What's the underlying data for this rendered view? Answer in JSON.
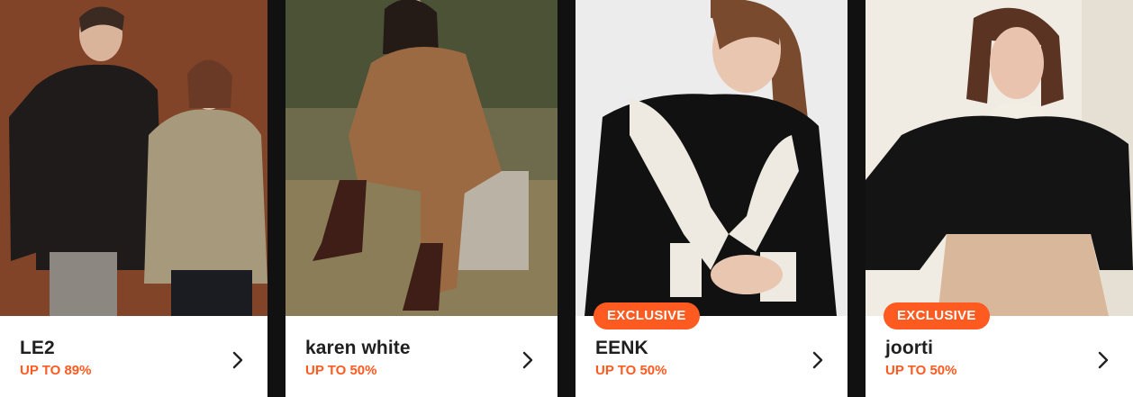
{
  "cards": [
    {
      "brand": "LE2",
      "discount": "UP TO 89%",
      "badge": "",
      "icon": "chevron-right-icon"
    },
    {
      "brand": "karen white",
      "discount": "UP TO 50%",
      "badge": "",
      "icon": "chevron-right-icon"
    },
    {
      "brand": "EENK",
      "discount": "UP TO 50%",
      "badge": "EXCLUSIVE",
      "icon": "chevron-right-icon"
    },
    {
      "brand": "joorti",
      "discount": "UP TO 50%",
      "badge": "EXCLUSIVE",
      "icon": "chevron-right-icon"
    }
  ],
  "colors": {
    "accent": "#ff5a1f",
    "text": "#1f1f1f",
    "card_bg": "#ffffff",
    "gap": "#111111"
  }
}
